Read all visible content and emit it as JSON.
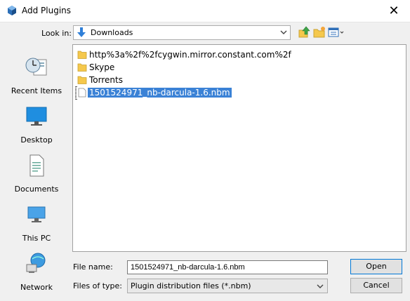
{
  "window": {
    "title": "Add Plugins",
    "close_glyph": "✕"
  },
  "toolbar": {
    "look_in_label": "Look in:",
    "look_in_value": "Downloads",
    "icons": [
      "up-folder-icon",
      "new-folder-icon",
      "view-menu-icon"
    ]
  },
  "places": [
    {
      "label": "Recent Items",
      "icon": "recent-items-icon"
    },
    {
      "label": "Desktop",
      "icon": "desktop-icon"
    },
    {
      "label": "Documents",
      "icon": "documents-icon"
    },
    {
      "label": "This PC",
      "icon": "this-pc-icon"
    },
    {
      "label": "Network",
      "icon": "network-icon"
    }
  ],
  "files": [
    {
      "name": "http%3a%2f%2fcygwin.mirror.constant.com%2f",
      "type": "folder"
    },
    {
      "name": "Skype",
      "type": "folder"
    },
    {
      "name": "Torrents",
      "type": "folder"
    },
    {
      "name": "1501524971_nb-darcula-1.6.nbm",
      "type": "file",
      "selected": true
    }
  ],
  "file_name": {
    "label": "File name:",
    "value": "1501524971_nb-darcula-1.6.nbm"
  },
  "file_type": {
    "label": "Files of type:",
    "value": "Plugin distribution files (*.nbm)"
  },
  "buttons": {
    "open": "Open",
    "cancel": "Cancel"
  },
  "colors": {
    "selection": "#3b82d6",
    "folder": "#f5c84c",
    "accent": "#0078d7"
  }
}
